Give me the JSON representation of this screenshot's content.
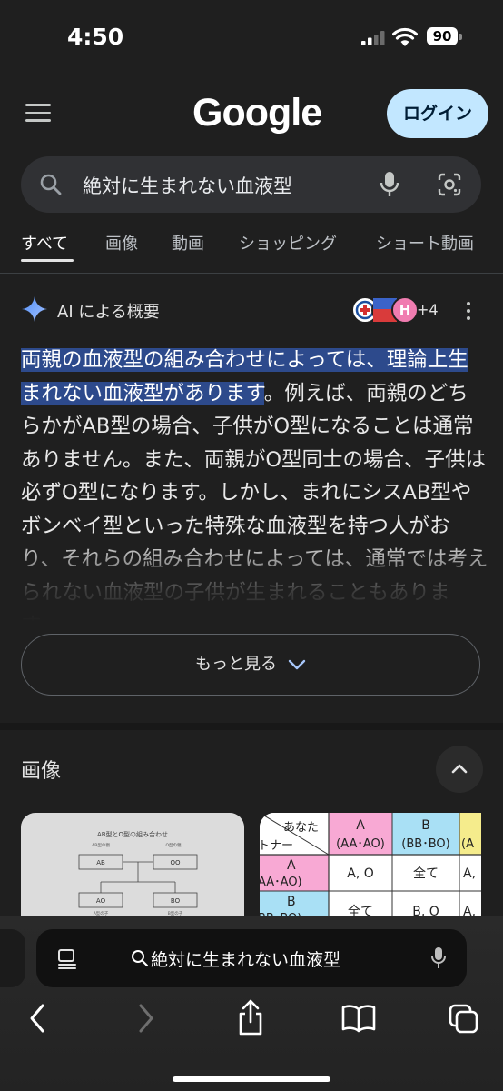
{
  "status_bar": {
    "time": "4:50",
    "battery": "90"
  },
  "header": {
    "logo": "Google",
    "login_label": "ログイン"
  },
  "search": {
    "query": "絶対に生まれない血液型"
  },
  "tabs": [
    {
      "label": "すべて",
      "active": true
    },
    {
      "label": "画像",
      "active": false
    },
    {
      "label": "動画",
      "active": false
    },
    {
      "label": "ショッピング",
      "active": false
    },
    {
      "label": "ショート動画",
      "active": false
    }
  ],
  "ai_overview": {
    "title": "AI による概要",
    "sources_more": "+4",
    "highlight_text": "両親の血液型の組み合わせによっては、理論上生まれない血液型があります",
    "body_text": "。例えば、両親のどちらかがAB型の場合、子供がO型になることは通常ありません。また、両親がO型同士の場合、子供は必ずO型になります。しかし、まれにシスAB型やボンベイ型といった特殊な血液型を持つ人がおり、それらの組み合わせによっては、通常では考えられない血液型の子供が生まれることもあります。",
    "more_label": "もっと見る"
  },
  "images": {
    "title": "画像",
    "card1": {
      "heading": "AB型とO型の組み合わせ",
      "parent1_caption": "AB型の親",
      "parent2_caption": "O型の親",
      "parent1": "AB",
      "parent2": "OO",
      "child1": "AO",
      "child2": "BO",
      "child1_caption": "A型の子",
      "child2_caption": "B型の子"
    },
    "card2": {
      "corner_top": "あなた",
      "corner_bottom": "トナー",
      "col_a": "A",
      "col_a_sub": "(AA･AO)",
      "col_b": "B",
      "col_b_sub": "(BB･BO)",
      "col_c": "(A",
      "row_a": "A",
      "row_a_sub": "AA･AO)",
      "row_b": "B",
      "row_b_sub": "BB･BO)",
      "cells": [
        [
          "A, O",
          "全て",
          "A,"
        ],
        [
          "全て",
          "B, O",
          "A,"
        ]
      ]
    }
  },
  "safari": {
    "address_text": "絶対に生まれない血液型"
  },
  "colors": {
    "background": "#1f1f1f",
    "highlight": "#2d4a8c",
    "login_bg": "#c2e7ff",
    "search_bg": "#303134",
    "pink_header": "#f8a9d4",
    "blue_header": "#a9e0f5",
    "yellow_header": "#f5ec8c"
  }
}
